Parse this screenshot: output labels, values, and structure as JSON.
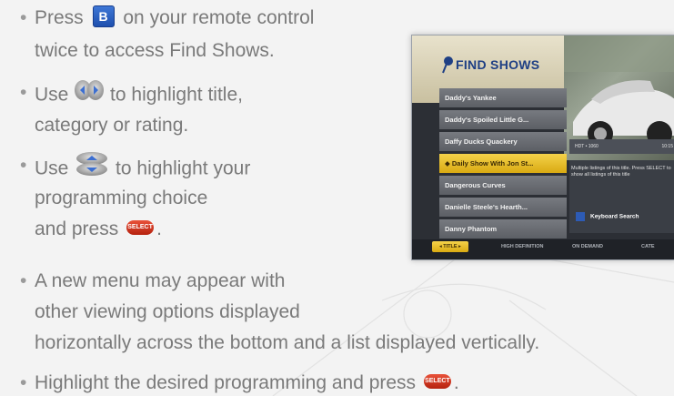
{
  "instructions": [
    {
      "before": "Press",
      "icon": "b-button-icon",
      "after": "on your remote control",
      "line2": "twice to access Find Shows."
    },
    {
      "before": "Use",
      "icon": "left-right-arrows-icon",
      "after": "to highlight title,",
      "line2": "category or rating."
    },
    {
      "before": "Use",
      "icon": "up-down-arrows-icon",
      "after": "to highlight your",
      "line2": "programming choice",
      "line3": "and press",
      "line3_icon": "select-button-icon",
      "line3_end": "."
    },
    {
      "line1": "A new menu may appear with",
      "line2": "other viewing options displayed",
      "line3": "horizontally across the bottom and a list displayed vertically."
    },
    {
      "before": "Highlight the desired programming and press",
      "icon": "select-button-icon",
      "after": "."
    }
  ],
  "remote": {
    "b_label": "B",
    "select_label": "SELECT"
  },
  "tv": {
    "title": "FIND SHOWS",
    "list": [
      "Daddy's Yankee",
      "Daddy's Spoiled Little G...",
      "Daffy Ducks Quackery",
      "Daily Show With Jon St...",
      "Dangerous Curves",
      "Danielle Steele's Hearth...",
      "Danny Phantom"
    ],
    "selected_index": 3,
    "info_bar": "HDT • 1060",
    "info_time": "10:15",
    "description": "Multiple listings of this title. Press SELECT to show all listings of this title",
    "keyboard_key": "5",
    "keyboard_label": "Keyboard Search",
    "tabs": [
      "TITLE",
      "HIGH DEFINITION",
      "ON DEMAND",
      "CATE"
    ],
    "colors": {
      "accent": "#f4d24a",
      "title": "#1e3f84",
      "panel": "#2c2f35"
    }
  }
}
